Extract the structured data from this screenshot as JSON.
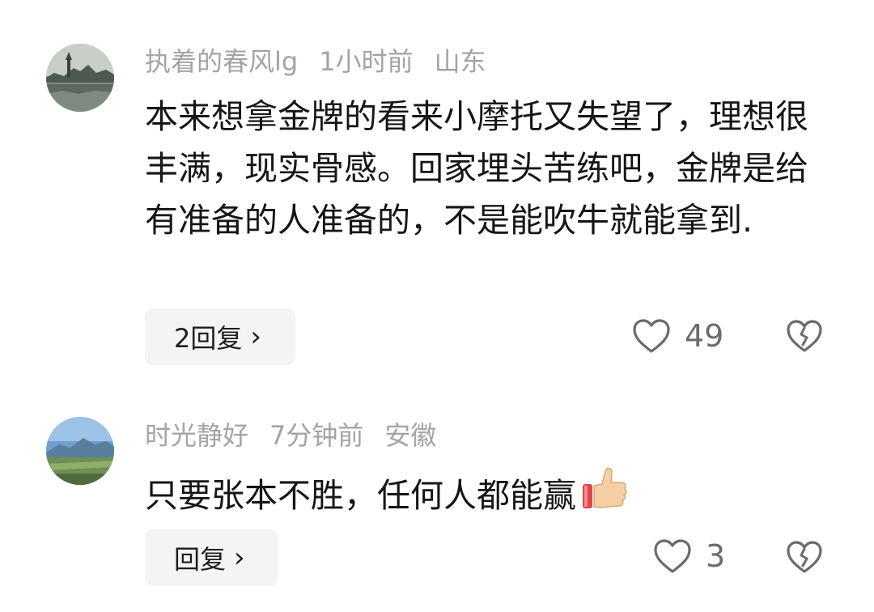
{
  "comments": [
    {
      "username": "执着的春风lg",
      "time": "1小时前",
      "location": "山东",
      "text": "本来想拿金牌的看来小摩托又失望了，理想很丰满，现实骨感。回家埋头苦练吧，金牌是给有准备的人准备的，不是能吹牛就能拿到.",
      "reply_label": "2回复",
      "likes": "49",
      "avatar_icon": "landscape-pagoda-icon"
    },
    {
      "username": "时光静好",
      "time": "7分钟前",
      "location": "安徽",
      "text": "只要张本不胜，任何人都能赢",
      "emoji_icon": "thumbs-up-icon",
      "reply_label": "回复",
      "likes": "3",
      "avatar_icon": "landscape-mountain-icon"
    }
  ],
  "colors": {
    "meta_text": "#a3a3a8",
    "body_text": "#161616",
    "reply_bg": "#f4f4f5",
    "icon_gray": "#6b6b6e"
  }
}
